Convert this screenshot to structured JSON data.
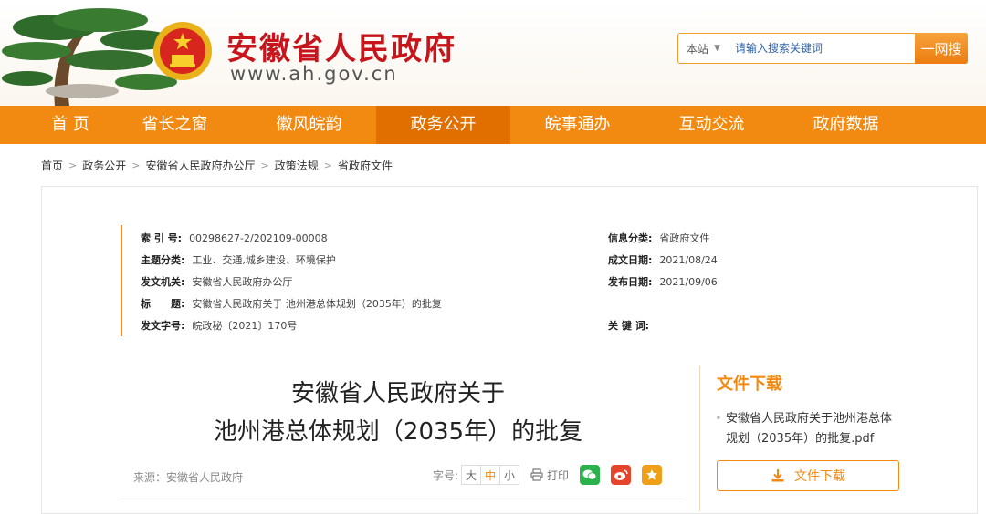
{
  "header": {
    "site_title": "安徽省人民政府",
    "site_url": "www.ah.gov.cn",
    "search": {
      "scope": "本站",
      "placeholder": "请输入搜索关键词",
      "button_label": "一网搜"
    }
  },
  "nav": {
    "items": [
      {
        "label": "首 页"
      },
      {
        "label": "省长之窗"
      },
      {
        "label": "徽风皖韵"
      },
      {
        "label": "政务公开"
      },
      {
        "label": "皖事通办"
      },
      {
        "label": "互动交流"
      },
      {
        "label": "政府数据"
      }
    ],
    "active_index": 3
  },
  "breadcrumb": [
    "首页",
    "政务公开",
    "安徽省人民政府办公厅",
    "政策法规",
    "省政府文件"
  ],
  "meta": {
    "index_no": {
      "key": "索 引 号:",
      "value": "00298627-2/202109-00008"
    },
    "topic": {
      "key": "主题分类:",
      "value": "工业、交通,城乡建设、环境保护"
    },
    "issuer": {
      "key": "发文机关:",
      "value": "安徽省人民政府办公厅"
    },
    "title": {
      "key": "标　　题:",
      "value": "安徽省人民政府关于 池州港总体规划（2035年）的批复"
    },
    "doc_no": {
      "key": "发文字号:",
      "value": "皖政秘〔2021〕170号"
    },
    "info_class": {
      "key": "信息分类:",
      "value": "省政府文件"
    },
    "created": {
      "key": "成文日期:",
      "value": "2021/08/24"
    },
    "published": {
      "key": "发布日期:",
      "value": "2021/09/06"
    },
    "keywords": {
      "key": "关 键 词:",
      "value": ""
    }
  },
  "document": {
    "title_line1": "安徽省人民政府关于",
    "title_line2": "池州港总体规划（2035年）的批复",
    "source": "来源：安徽省人民政府",
    "font_size_label": "字号:",
    "font_sizes": [
      "大",
      "中",
      "小"
    ],
    "print_label": "打印"
  },
  "download": {
    "title": "文件下载",
    "file_name": "安徽省人民政府关于池州港总体规划（2035年）的批复.pdf",
    "button_label": "文件下载"
  },
  "colors": {
    "brand_orange": "#f28a12",
    "brand_red": "#c8141b",
    "nav_active": "#e06f00"
  }
}
